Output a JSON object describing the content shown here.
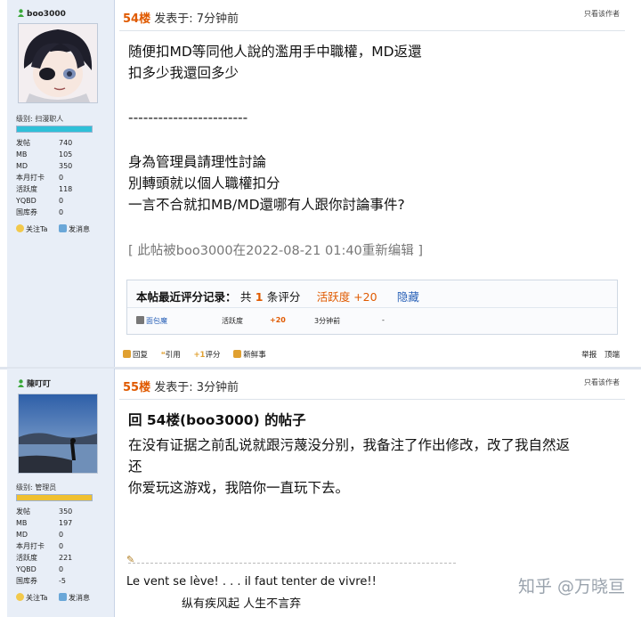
{
  "posts": [
    {
      "user": {
        "name": "boo3000",
        "level_label": "级别: 扫漫职人",
        "level_fill": 1.0,
        "stats": [
          {
            "k": "发帖",
            "v": "740"
          },
          {
            "k": "MB",
            "v": "105"
          },
          {
            "k": "MD",
            "v": "350"
          },
          {
            "k": "本月打卡",
            "v": "0"
          },
          {
            "k": "活跃度",
            "v": "118"
          },
          {
            "k": "YQBD",
            "v": "0"
          },
          {
            "k": "国库券",
            "v": "0"
          }
        ],
        "follow_label": "关注Ta",
        "message_label": "发消息"
      },
      "floor": "54楼",
      "posted": "发表于: 7分钟前",
      "only_author": "只看该作者",
      "lines": [
        "随便扣MD等同他人說的濫用手中職權，MD返還",
        "扣多少我還回多少",
        "",
        "------------------------",
        "",
        "身為管理員請理性討論",
        "別轉頭就以個人職權扣分",
        "一言不合就扣MB/MD還哪有人跟你討論事件?"
      ],
      "edit_note": "[ 此帖被boo3000在2022-08-21 01:40重新编辑 ]",
      "rating": {
        "title_prefix": "本帖最近评分记录：",
        "total_prefix": "共",
        "count": "1",
        "total_suffix": "条评分",
        "activity": "活跃度 +20",
        "hide": "隐藏",
        "row": {
          "user": "面包魔",
          "item": "活跃度",
          "value": "+20",
          "time": "3分钟前",
          "reason": "-"
        }
      },
      "footer": {
        "reply": "回复",
        "quote": "引用",
        "rate": "评分",
        "new": "新鲜事",
        "report": "举报",
        "top": "顶端"
      }
    },
    {
      "user": {
        "name": "陳叮叮",
        "level_label": "级别: 管理员",
        "level_fill": 1.0,
        "stats": [
          {
            "k": "发帖",
            "v": "350"
          },
          {
            "k": "MB",
            "v": "197"
          },
          {
            "k": "MD",
            "v": "0"
          },
          {
            "k": "本月打卡",
            "v": "0"
          },
          {
            "k": "活跃度",
            "v": "221"
          },
          {
            "k": "YQBD",
            "v": "0"
          },
          {
            "k": "国库券",
            "v": "-5"
          }
        ],
        "follow_label": "关注Ta",
        "message_label": "发消息"
      },
      "floor": "55楼",
      "posted": "发表于: 3分钟前",
      "only_author": "只看该作者",
      "reply_title": "回 54楼(boo3000) 的帖子",
      "lines": [
        "在没有证据之前乱说就跟污蔑没分别，我备注了作出修改，改了我自然返",
        "还",
        "你爱玩这游戏，我陪你一直玩下去。"
      ],
      "signature": [
        "Le vent se lève! . . . il faut tenter de vivre!!",
        "纵有疾风起 人生不言弃"
      ]
    }
  ],
  "watermark": "知乎 @万晓亘",
  "colors": {
    "floor": "#e05a00",
    "link": "#2a62b8",
    "sidebar": "#e8eef7",
    "level_bar": "#2fc0d8",
    "admin_bar": "#f0c030"
  }
}
